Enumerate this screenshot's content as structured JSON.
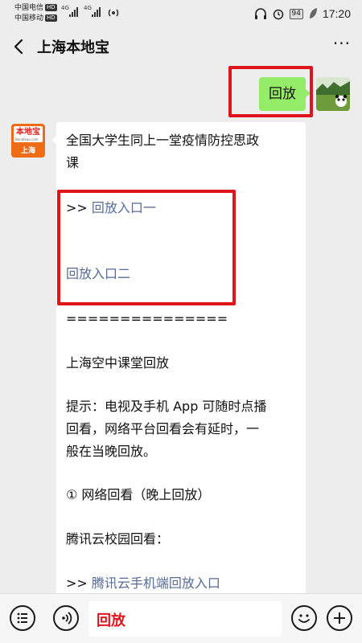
{
  "status_bar": {
    "carrier1": "中国电信",
    "carrier2": "中国移动",
    "hd": "HD",
    "network": "4G",
    "battery": "94",
    "time": "17:20"
  },
  "header": {
    "title": "上海本地宝",
    "more": "···"
  },
  "messages": {
    "my_message": "回放",
    "their_avatar": {
      "brand": "本地宝",
      "url": "Bendibao.com",
      "city": "上海"
    },
    "article_lines": [
      {
        "prefix": "",
        "text": "全国大学生同上一堂疫情防控思政"
      },
      {
        "prefix": "",
        "text": "课"
      },
      {
        "prefix": ">> ",
        "link": "回放入口一"
      },
      {
        "prefix": "",
        "link": "回放入口二"
      },
      {
        "prefix": "",
        "text": "==============="
      },
      {
        "prefix": "",
        "text": "上海空中课堂回放"
      },
      {
        "prefix": "",
        "text": "提示：电视及手机 App 可随时点播"
      },
      {
        "prefix": "",
        "text": "回看，网络平台回看会有延时，一"
      },
      {
        "prefix": "",
        "text": "般在当晚回放。"
      },
      {
        "prefix": "",
        "text": "① 网络回看（晚上回放）"
      },
      {
        "prefix": "",
        "text": "腾讯云校园回看："
      },
      {
        "prefix": ">> ",
        "link": "腾讯云手机端回放入口"
      }
    ]
  },
  "input": {
    "value": "回放"
  },
  "colors": {
    "accent_red": "#e0141b",
    "bubble_green": "#95ec69",
    "link_blue": "#576b95"
  }
}
